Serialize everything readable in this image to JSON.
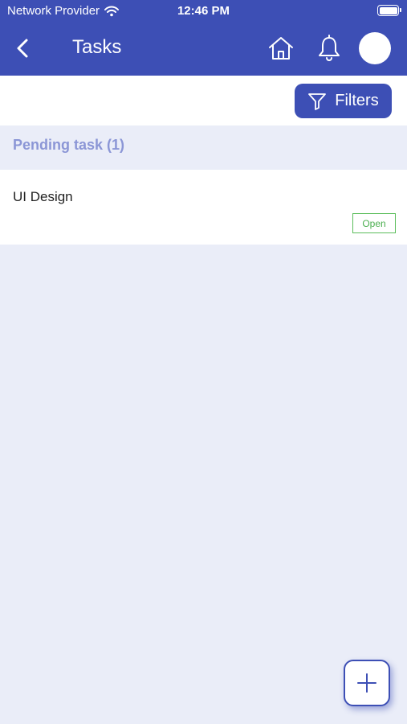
{
  "status_bar": {
    "carrier": "Network Provider",
    "time": "12:46 PM"
  },
  "header": {
    "title": "Tasks",
    "icons": [
      "chevron-left-icon",
      "home-icon",
      "bell-icon",
      "avatar"
    ]
  },
  "toolbar": {
    "filters_label": "Filters"
  },
  "section": {
    "title": "Pending task (1)"
  },
  "tasks": [
    {
      "title": "UI Design",
      "status": "Open"
    }
  ],
  "colors": {
    "primary": "#3d4fb5",
    "background": "#eaedf8",
    "section_text": "#8b96d6",
    "status_open": "#4caf50"
  }
}
